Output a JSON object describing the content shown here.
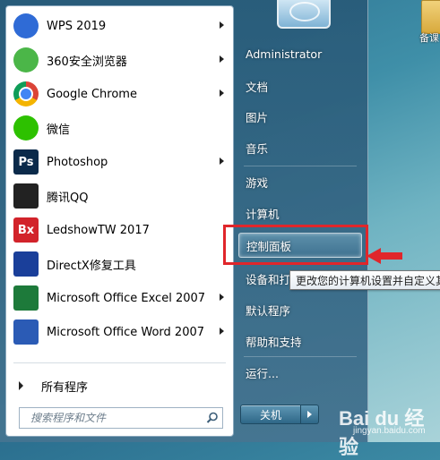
{
  "desktop": {
    "icon_label": "备课"
  },
  "programs": [
    {
      "label": "WPS 2019",
      "icon": "wps-icon",
      "color": "#2f6bd6",
      "arrow": true
    },
    {
      "label": "360安全浏览器",
      "icon": "360-browser-icon",
      "color": "#4bb648",
      "arrow": true
    },
    {
      "label": "Google Chrome",
      "icon": "chrome-icon",
      "color": "#db4437",
      "arrow": true
    },
    {
      "label": "微信",
      "icon": "wechat-icon",
      "color": "#2dc100",
      "arrow": false
    },
    {
      "label": "Photoshop",
      "icon": "photoshop-icon",
      "color": "#0b2a4a",
      "icon_text": "Ps",
      "arrow": true
    },
    {
      "label": "腾讯QQ",
      "icon": "qq-icon",
      "color": "#222222",
      "arrow": false
    },
    {
      "label": "LedshowTW 2017",
      "icon": "ledshow-icon",
      "color": "#d2232a",
      "icon_text": "Bx",
      "arrow": false
    },
    {
      "label": "DirectX修复工具",
      "icon": "directx-icon",
      "color": "#1a3f9a",
      "arrow": false
    },
    {
      "label": "Microsoft Office Excel 2007",
      "icon": "excel-icon",
      "color": "#1d7a3a",
      "arrow": true
    },
    {
      "label": "Microsoft Office Word 2007",
      "icon": "word-icon",
      "color": "#2b5bb5",
      "arrow": true
    }
  ],
  "all_programs": "所有程序",
  "search": {
    "placeholder": "搜索程序和文件"
  },
  "right_items": [
    "Administrator",
    "文档",
    "图片",
    "音乐",
    "游戏",
    "计算机",
    "控制面板",
    "设备和打",
    "默认程序",
    "帮助和支持",
    "运行..."
  ],
  "tooltip": "更改您的计算机设置并自定义其",
  "shutdown": {
    "label": "关机"
  },
  "watermark": {
    "main": "Bai du 经验",
    "sub": "jingyan.baidu.com"
  },
  "colors": {
    "highlight_border": "#e0262b"
  }
}
